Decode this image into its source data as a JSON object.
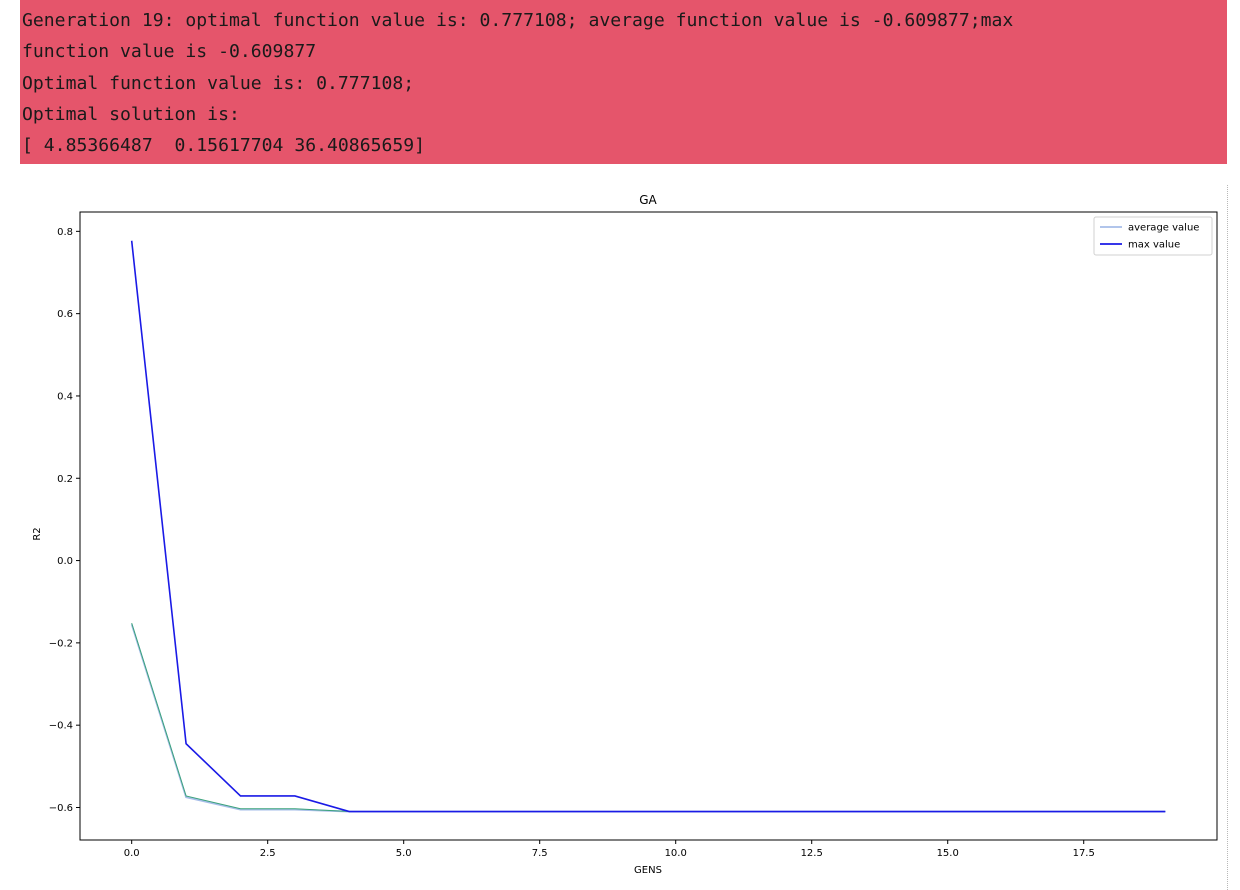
{
  "console": {
    "lines": [
      "Generation 19: optimal function value is: 0.777108; average function value is -0.609877;max",
      "function value is -0.609877",
      "Optimal function value is: 0.777108;",
      "Optimal solution is:",
      "[ 4.85366487  0.15617704 36.40865659]"
    ],
    "background": "#e5556b"
  },
  "chart_data": {
    "type": "line",
    "title": "GA",
    "xlabel": "GENS",
    "ylabel": "R2",
    "xlim": [
      -0.95,
      19.95
    ],
    "ylim": [
      -0.679,
      0.847
    ],
    "x_ticks": [
      0.0,
      2.5,
      5.0,
      7.5,
      10.0,
      12.5,
      15.0,
      17.5
    ],
    "x_tick_labels": [
      "0.0",
      "2.5",
      "5.0",
      "7.5",
      "10.0",
      "12.5",
      "15.0",
      "17.5"
    ],
    "y_ticks": [
      0.8,
      0.6,
      0.4,
      0.2,
      0.0,
      -0.2,
      -0.4,
      -0.6
    ],
    "y_tick_labels": [
      "0.8",
      "0.6",
      "0.4",
      "0.2",
      "0.0",
      "−0.2",
      "−0.4",
      "−0.6"
    ],
    "grid": false,
    "legend_position": "top-right",
    "x": [
      0,
      1,
      2,
      3,
      4,
      5,
      6,
      7,
      8,
      9,
      10,
      11,
      12,
      13,
      14,
      15,
      16,
      17,
      18,
      19
    ],
    "series": [
      {
        "name": "average value",
        "color": "#a6bde8",
        "values": [
          -0.155,
          -0.575,
          -0.605,
          -0.605,
          -0.609877,
          -0.609877,
          -0.609877,
          -0.609877,
          -0.609877,
          -0.609877,
          -0.609877,
          -0.609877,
          -0.609877,
          -0.609877,
          -0.609877,
          -0.609877,
          -0.609877,
          -0.609877,
          -0.609877,
          -0.609877
        ]
      },
      {
        "name": "max value",
        "color": "#1a1ae6",
        "values": [
          0.777108,
          -0.445,
          -0.572,
          -0.572,
          -0.609877,
          -0.609877,
          -0.609877,
          -0.609877,
          -0.609877,
          -0.609877,
          -0.609877,
          -0.609877,
          -0.609877,
          -0.609877,
          -0.609877,
          -0.609877,
          -0.609877,
          -0.609877,
          -0.609877,
          -0.609877
        ]
      }
    ],
    "secondary_trace": {
      "color": "#3aa37a",
      "values": [
        -0.152,
        -0.572,
        -0.603,
        -0.603,
        -0.609877,
        -0.609877,
        -0.609877,
        -0.609877,
        -0.609877,
        -0.609877,
        -0.609877,
        -0.609877,
        -0.609877,
        -0.609877,
        -0.609877,
        -0.609877,
        -0.609877,
        -0.609877,
        -0.609877,
        -0.609877
      ]
    }
  }
}
